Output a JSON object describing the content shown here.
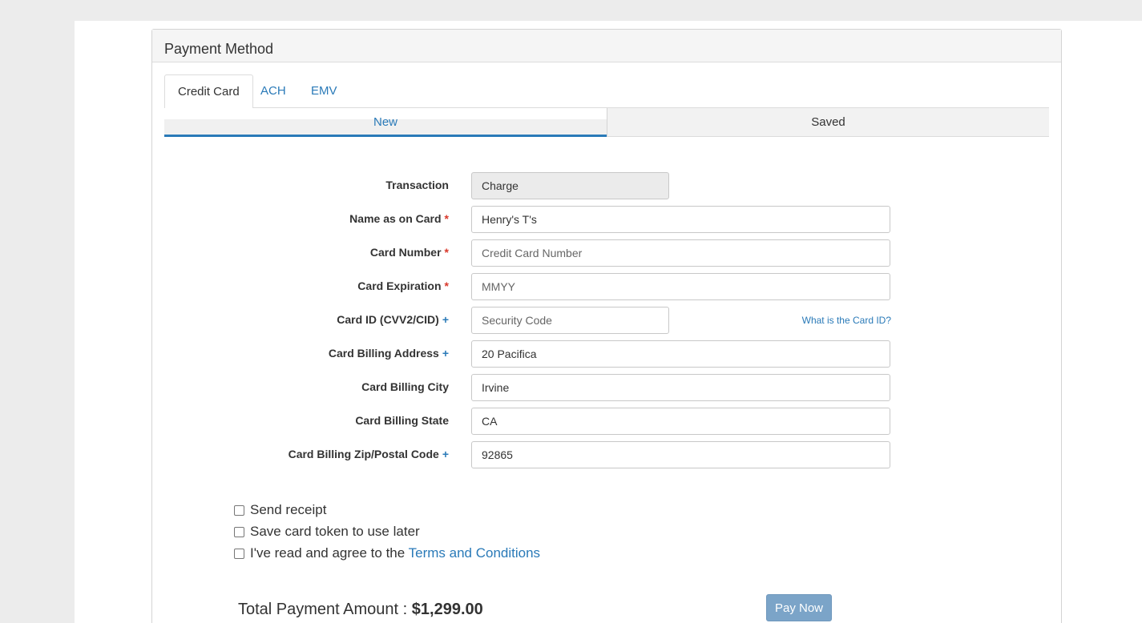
{
  "panel": {
    "title": "Payment Method"
  },
  "tabs": [
    {
      "label": "Credit Card",
      "active": true
    },
    {
      "label": "ACH",
      "active": false
    },
    {
      "label": "EMV",
      "active": false
    }
  ],
  "subtabs": [
    {
      "label": "New",
      "active": true
    },
    {
      "label": "Saved",
      "active": false
    }
  ],
  "form": {
    "transaction": {
      "label": "Transaction",
      "value": "Charge"
    },
    "name": {
      "label": "Name as on Card",
      "mark": "*",
      "value": "Henry's T's"
    },
    "card_number": {
      "label": "Card Number",
      "mark": "*",
      "placeholder": "Credit Card Number"
    },
    "expiration": {
      "label": "Card Expiration",
      "mark": "*",
      "placeholder": "MMYY"
    },
    "card_id": {
      "label": "Card ID (CVV2/CID)",
      "mark": "+",
      "placeholder": "Security Code",
      "help": "What is the Card ID?"
    },
    "address": {
      "label": "Card Billing Address",
      "mark": "+",
      "value": "20 Pacifica"
    },
    "city": {
      "label": "Card Billing City",
      "value": "Irvine"
    },
    "state": {
      "label": "Card Billing State",
      "value": "CA"
    },
    "zip": {
      "label": "Card Billing Zip/Postal Code",
      "mark": "+",
      "value": "92865"
    }
  },
  "options": {
    "send_receipt": "Send receipt",
    "save_token": "Save card token to use later",
    "agree_prefix": "I've read and agree to the",
    "terms_link": "Terms and Conditions"
  },
  "summary": {
    "total_label": "Total Payment Amount :",
    "total_amount": "$1,299.00",
    "pay_button": "Pay Now"
  },
  "colors": {
    "accent": "#2a7ab8",
    "required": "#d9382b",
    "pay_button": "#7ba4c8"
  }
}
